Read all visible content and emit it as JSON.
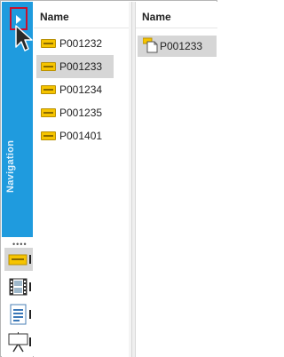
{
  "navigation": {
    "label": "Navigation",
    "expand_button": "expand",
    "accent_color": "#1f9bde",
    "highlight_color": "#c8102e"
  },
  "left_panel": {
    "column_header": "Name",
    "items": [
      {
        "label": "P001232",
        "icon": "ticket-icon",
        "selected": false
      },
      {
        "label": "P001233",
        "icon": "ticket-icon",
        "selected": true
      },
      {
        "label": "P001234",
        "icon": "ticket-icon",
        "selected": false
      },
      {
        "label": "P001235",
        "icon": "ticket-icon",
        "selected": false
      },
      {
        "label": "P001401",
        "icon": "ticket-icon",
        "selected": false
      }
    ]
  },
  "right_panel": {
    "column_header": "Name",
    "items": [
      {
        "label": "P001233",
        "icon": "ticket-document-icon",
        "selected": true
      }
    ]
  },
  "rail_icons": [
    {
      "name": "ticket-icon",
      "active": true
    },
    {
      "name": "film-icon",
      "active": false
    },
    {
      "name": "document-icon",
      "active": false
    },
    {
      "name": "presentation-icon",
      "active": false
    }
  ]
}
